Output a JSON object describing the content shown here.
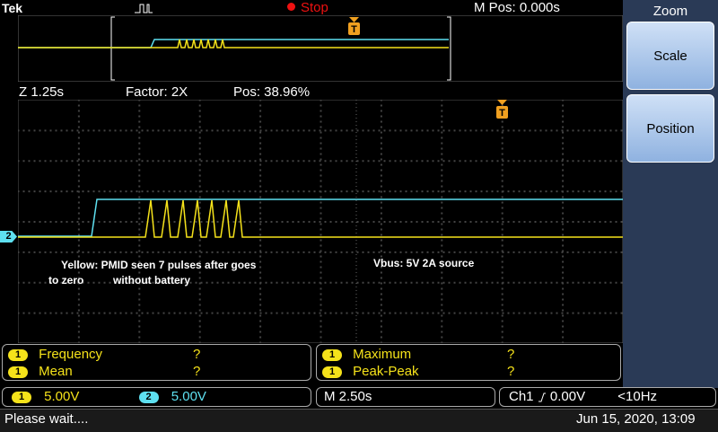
{
  "header": {
    "brand": "Tek",
    "run_state": "Stop",
    "m_pos": "M Pos: 0.000s"
  },
  "zoom_info": {
    "z": "Z 1.25s",
    "factor": "Factor: 2X",
    "pos": "Pos: 38.96%"
  },
  "annotations": {
    "yellow_note_line1": "Yellow: PMID seen 7 pulses after goes",
    "yellow_note_line2": "to zero",
    "yellow_note_line3": "without battery",
    "vbus_note": "Vbus: 5V 2A source"
  },
  "side_menu": {
    "title": "Zoom",
    "scale": "Scale",
    "position": "Position"
  },
  "measurements": {
    "left": [
      {
        "channel": "1",
        "label": "Frequency",
        "value": "?"
      },
      {
        "channel": "1",
        "label": "Mean",
        "value": "?"
      }
    ],
    "right": [
      {
        "channel": "1",
        "label": "Maximum",
        "value": "?"
      },
      {
        "channel": "1",
        "label": "Peak-Peak",
        "value": "?"
      }
    ]
  },
  "channels": {
    "ch1": {
      "num": "1",
      "scale": "5.00V"
    },
    "ch2": {
      "num": "2",
      "scale": "5.00V"
    }
  },
  "timebase": "M 2.50s",
  "trigger": {
    "source": "Ch1",
    "slope_icon": "rising-edge-icon",
    "level": "0.00V",
    "freq": "<10Hz"
  },
  "ch2_marker": "2",
  "trigger_marker": "T",
  "status": "Please wait....",
  "datetime": "Jun 15, 2020, 13:09",
  "colors": {
    "ch1": "#f5e21a",
    "ch2": "#5ee0f0",
    "stop": "#e11111",
    "trigger": "#f0a020"
  }
}
